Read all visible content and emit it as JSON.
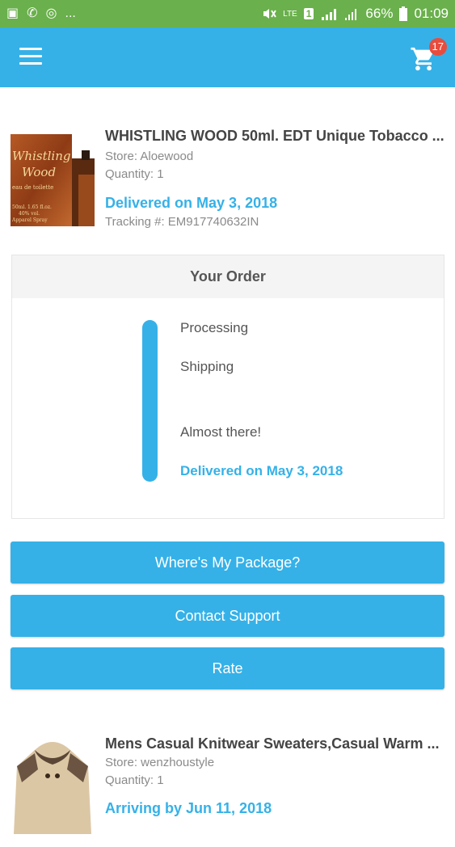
{
  "status_bar": {
    "left_glyphs": [
      "▣",
      "✆",
      "◎",
      "..."
    ],
    "battery": "66%",
    "time": "01:09",
    "lte_label": "LTE",
    "sim_label": "1"
  },
  "header": {
    "cart_count": "17"
  },
  "items": [
    {
      "title": "WHISTLING WOOD 50ml. EDT Unique Tobacco ...",
      "store": "Store: Aloewood",
      "quantity": "Quantity: 1",
      "delivery": "Delivered on May 3, 2018",
      "tracking": "Tracking #: EM917740632IN",
      "image_text": [
        "Whistling",
        "Wood",
        "eau de toilette",
        "50ml. 1.65 fl.oz.",
        "40% vol.",
        "Apparel Spray"
      ]
    },
    {
      "title": "Mens Casual Knitwear Sweaters,Casual Warm ...",
      "store": "Store: wenzhoustyle",
      "quantity": "Quantity: 1",
      "delivery": "Arriving by Jun 11, 2018"
    }
  ],
  "order_card": {
    "title": "Your Order",
    "steps": [
      "Processing",
      "Shipping",
      "Almost there!",
      "Delivered on May 3, 2018"
    ]
  },
  "buttons": {
    "wheres_package": "Where's My Package?",
    "contact_support": "Contact Support",
    "rate": "Rate"
  },
  "colors": {
    "primary": "#35b1e8",
    "status_bar": "#6ab04c",
    "badge": "#e84c3d"
  }
}
